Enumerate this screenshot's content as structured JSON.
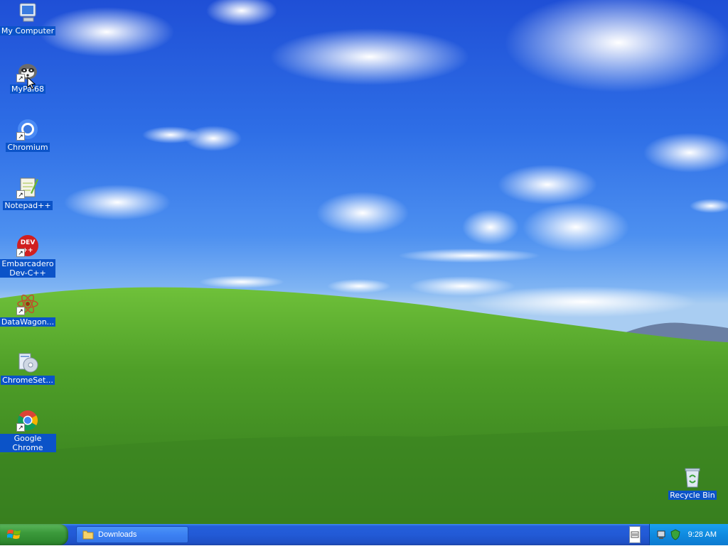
{
  "desktop_icons": [
    {
      "id": "my-computer",
      "label": "My Computer"
    },
    {
      "id": "mypal68",
      "label": "MyPal68"
    },
    {
      "id": "chromium",
      "label": "Chromium"
    },
    {
      "id": "notepadpp",
      "label": "Notepad++"
    },
    {
      "id": "devcpp",
      "label": "Embarcadero\nDev-C++",
      "icon_text": "DEV\n++"
    },
    {
      "id": "datawagon",
      "label": "DataWagon..."
    },
    {
      "id": "chromesetup",
      "label": "ChromeSet..."
    },
    {
      "id": "google-chrome",
      "label": "Google Chrome"
    },
    {
      "id": "recycle-bin",
      "label": "Recycle Bin"
    }
  ],
  "taskbar": {
    "start_label": "",
    "tasks": [
      {
        "label": "Downloads",
        "icon": "folder-icon"
      }
    ],
    "clock": "9:28 AM"
  },
  "colors": {
    "sky": "#2e6ee6",
    "grass": "#4f9a2b",
    "taskbar": "#245edb",
    "start": "#3c9a3c",
    "tray": "#0f8be0"
  }
}
